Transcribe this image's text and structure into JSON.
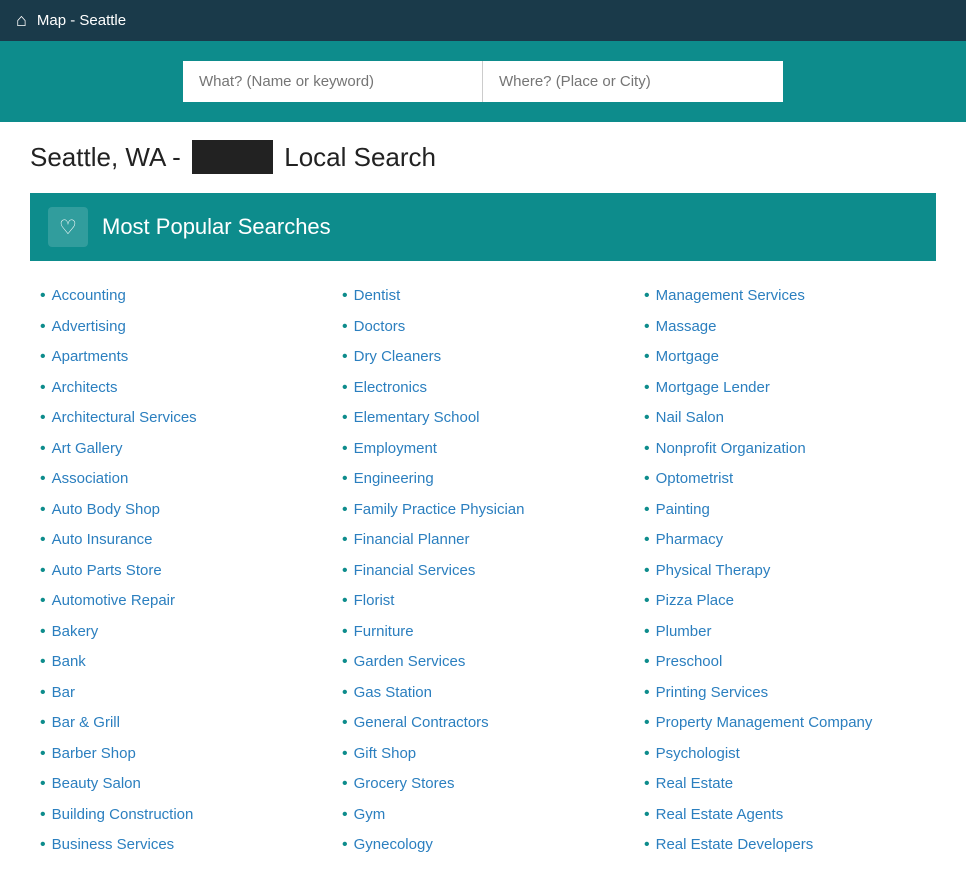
{
  "topbar": {
    "site_title": "Map - Seattle"
  },
  "search": {
    "what_placeholder": "What? (Name or keyword)",
    "where_placeholder": "Where? (Place or City)"
  },
  "heading": {
    "prefix": "Seattle, WA -",
    "highlighted": "        ",
    "suffix": "Local Search"
  },
  "popular_header": {
    "label": "Most Popular Searches"
  },
  "columns": [
    {
      "items": [
        "Accounting",
        "Advertising",
        "Apartments",
        "Architects",
        "Architectural Services",
        "Art Gallery",
        "Association",
        "Auto Body Shop",
        "Auto Insurance",
        "Auto Parts Store",
        "Automotive Repair",
        "Bakery",
        "Bank",
        "Bar",
        "Bar & Grill",
        "Barber Shop",
        "Beauty Salon",
        "Building Construction",
        "Business Services"
      ]
    },
    {
      "items": [
        "Dentist",
        "Doctors",
        "Dry Cleaners",
        "Electronics",
        "Elementary School",
        "Employment",
        "Engineering",
        "Family Practice Physician",
        "Financial Planner",
        "Financial Services",
        "Florist",
        "Furniture",
        "Garden Services",
        "Gas Station",
        "General Contractors",
        "Gift Shop",
        "Grocery Stores",
        "Gym",
        "Gynecology"
      ]
    },
    {
      "items": [
        "Management Services",
        "Massage",
        "Mortgage",
        "Mortgage Lender",
        "Nail Salon",
        "Nonprofit Organization",
        "Optometrist",
        "Painting",
        "Pharmacy",
        "Physical Therapy",
        "Pizza Place",
        "Plumber",
        "Preschool",
        "Printing Services",
        "Property Management Company",
        "Psychologist",
        "Real Estate",
        "Real Estate Agents",
        "Real Estate Developers"
      ]
    }
  ]
}
